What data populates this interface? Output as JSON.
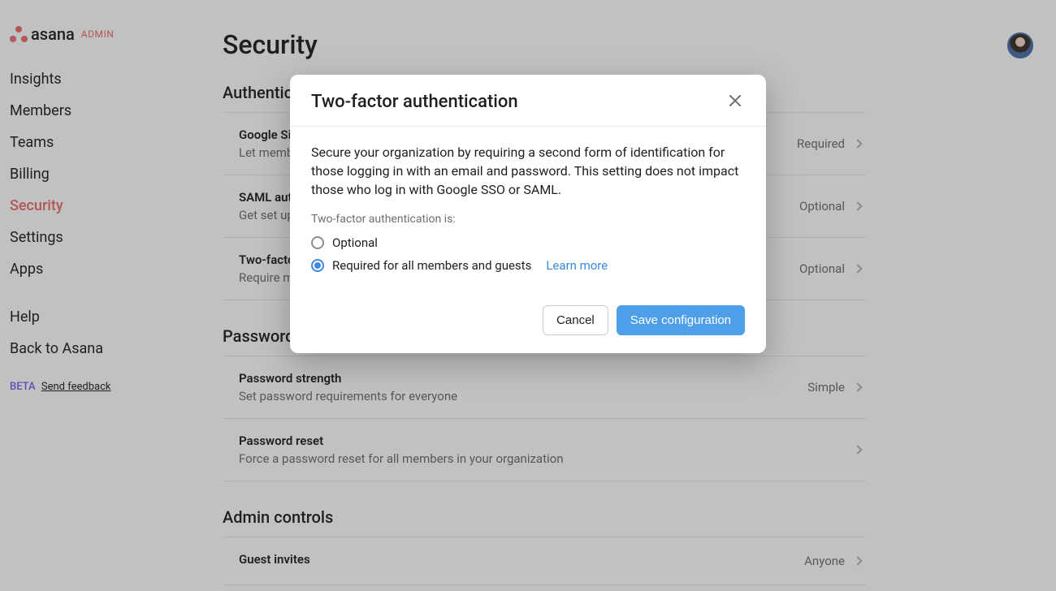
{
  "brand": {
    "name": "asana",
    "admin_label": "ADMIN"
  },
  "sidebar": {
    "main_items": [
      {
        "label": "Insights"
      },
      {
        "label": "Members"
      },
      {
        "label": "Teams"
      },
      {
        "label": "Billing"
      },
      {
        "label": "Security",
        "active": true
      },
      {
        "label": "Settings"
      },
      {
        "label": "Apps"
      }
    ],
    "secondary_items": [
      {
        "label": "Help"
      },
      {
        "label": "Back to Asana"
      }
    ],
    "beta_tag": "BETA",
    "feedback_label": "Send feedback"
  },
  "page": {
    "title": "Security"
  },
  "sections": {
    "auth": {
      "title": "Authentication",
      "rows": [
        {
          "title": "Google Sign-In",
          "desc": "Let members sign in with Google",
          "value": "Required"
        },
        {
          "title": "SAML authentication",
          "desc": "Get set up with SAML-based single sign-on",
          "value": "Optional"
        },
        {
          "title": "Two-factor authentication",
          "desc": "Require members to use two-factor authentication",
          "value": "Optional"
        }
      ]
    },
    "password": {
      "title": "Password settings",
      "rows": [
        {
          "title": "Password strength",
          "desc": "Set password requirements for everyone",
          "value": "Simple"
        },
        {
          "title": "Password reset",
          "desc": "Force a password reset for all members in your organization",
          "value": ""
        }
      ]
    },
    "admin": {
      "title": "Admin controls",
      "rows": [
        {
          "title": "Guest invites",
          "desc": "",
          "value": "Anyone"
        }
      ]
    }
  },
  "modal": {
    "title": "Two-factor authentication",
    "description": "Secure your organization by requiring a second form of identification for those logging in with an email and password. This setting does not impact those who log in with Google SSO or SAML.",
    "radio_label": "Two-factor authentication is:",
    "options": {
      "optional": "Optional",
      "required": "Required for all members and guests"
    },
    "learn_more": "Learn more",
    "cancel": "Cancel",
    "save": "Save configuration"
  }
}
